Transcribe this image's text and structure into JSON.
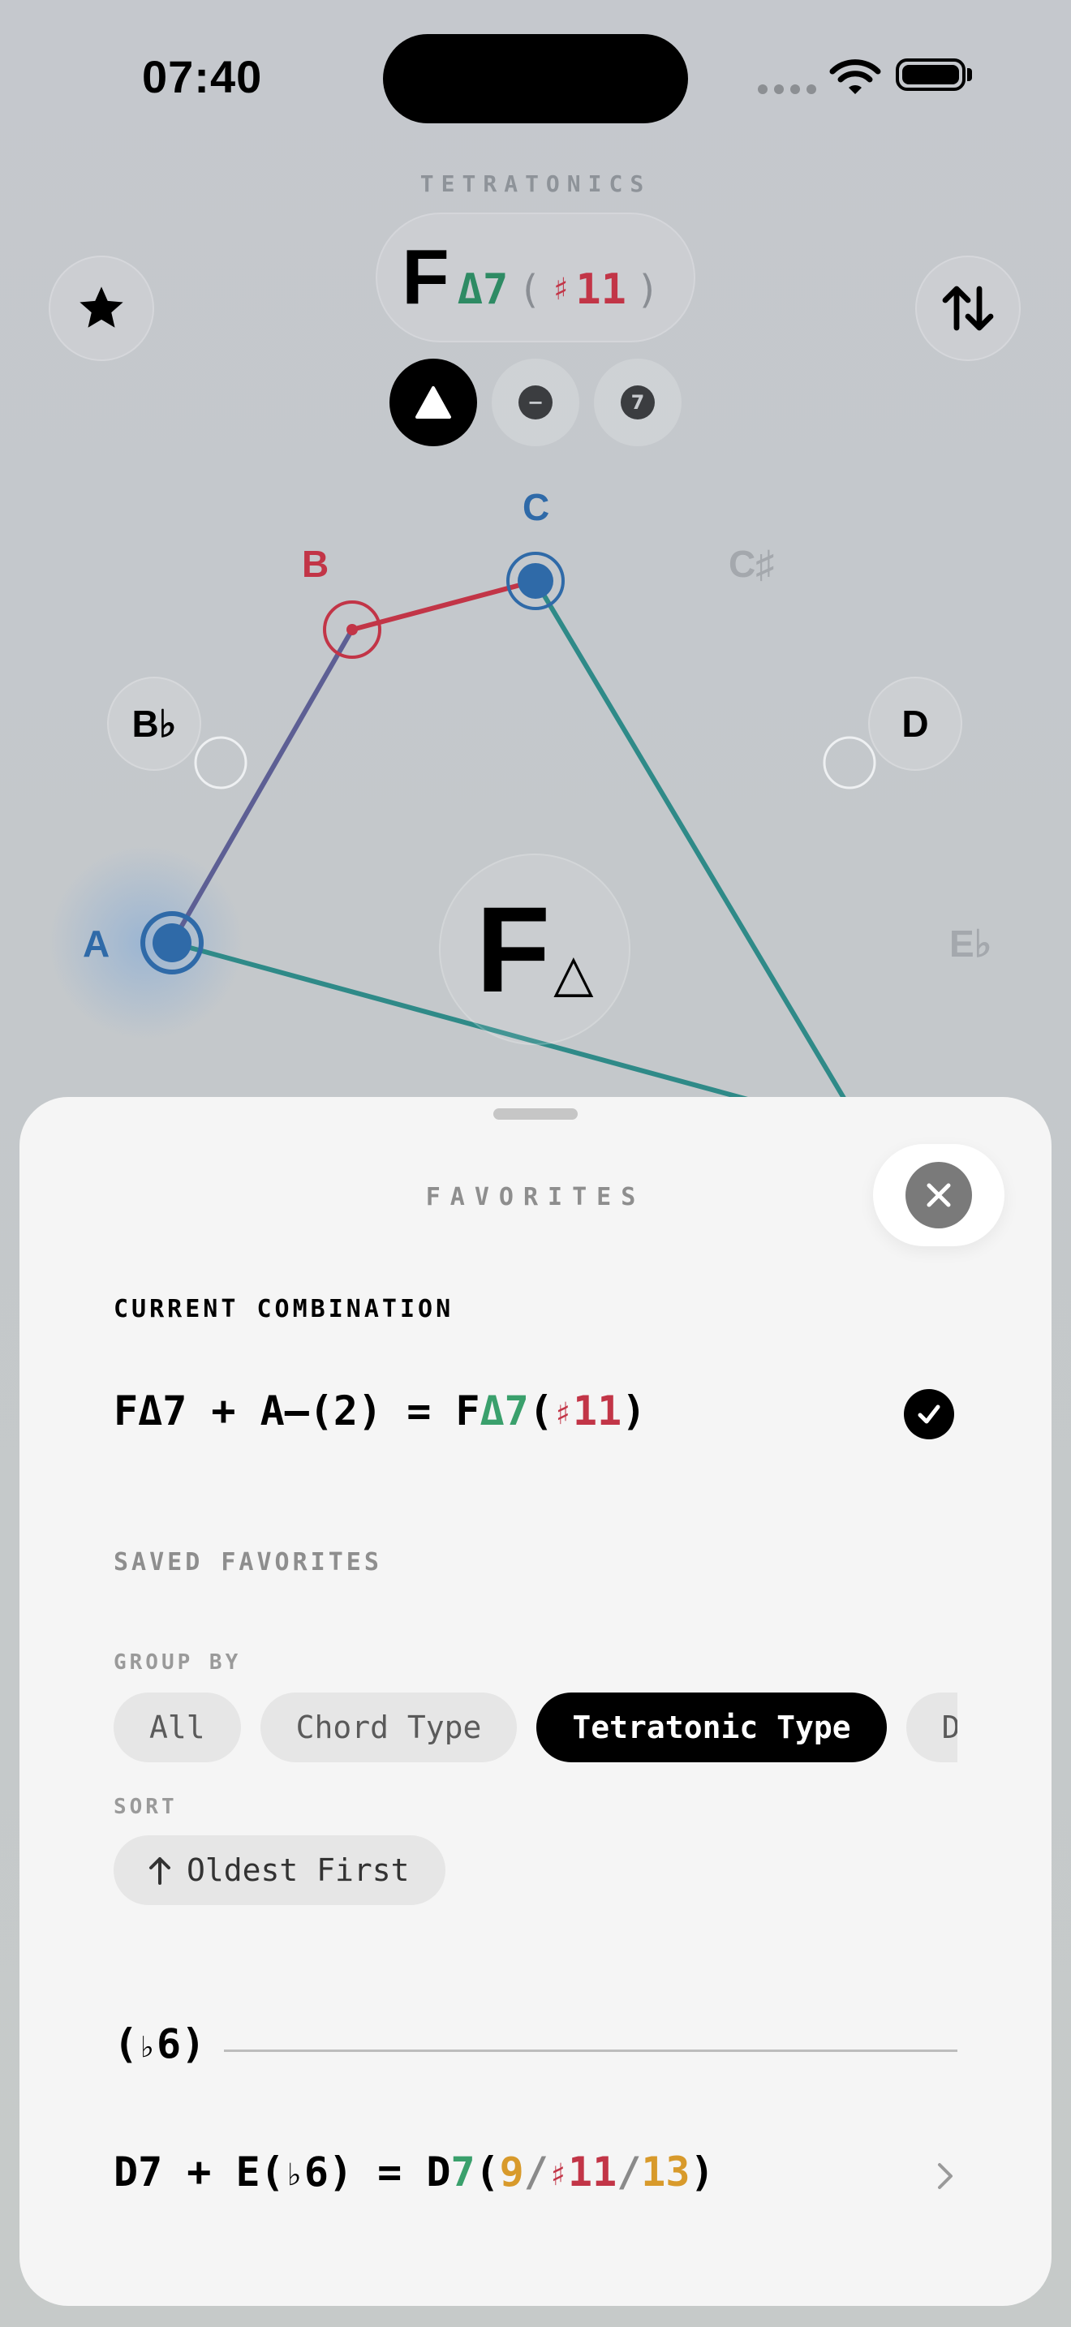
{
  "status_bar": {
    "time": "07:40"
  },
  "header": {
    "mode_label": "TETRATONICS",
    "chord": {
      "root": "F",
      "quality": "Δ7",
      "open_paren": "(",
      "sharp": "♯",
      "extension": "11",
      "close_paren": ")"
    },
    "segments": [
      {
        "name": "triangle",
        "active": true
      },
      {
        "name": "minus",
        "active": false,
        "glyph": "−"
      },
      {
        "name": "seven",
        "active": false,
        "glyph": "7"
      }
    ]
  },
  "circle": {
    "notes": {
      "c": "C",
      "b": "B",
      "csharp": "C♯",
      "bflat": "B♭",
      "d": "D",
      "a": "A",
      "eflat": "E♭"
    },
    "center": {
      "root": "F",
      "symbol": "△"
    }
  },
  "sheet": {
    "title": "FAVORITES",
    "current_heading": "CURRENT COMBINATION",
    "current": {
      "lhs": "FΔ7 + A–(2) = F",
      "q": "Δ7",
      "op": "(",
      "sharp": "♯",
      "ext": "11",
      "cp": ")"
    },
    "saved_heading": "SAVED FAVORITES",
    "group_by_label": "GROUP BY",
    "group_chips": [
      "All",
      "Chord Type",
      "Tetratonic Type",
      "Date"
    ],
    "sort_label": "SORT",
    "sort_value": "Oldest First",
    "group_title": {
      "op": "(",
      "flat": "♭",
      "num": "6",
      "cp": ")"
    },
    "item": {
      "lhs_a": "D7 + E(",
      "flat": "♭",
      "lhs_b": "6) = D",
      "q": "7",
      "op": "(",
      "e1": "9",
      "s1": "/",
      "sharp": "♯",
      "e2": "11",
      "s2": "/",
      "e3": "13",
      "cp": ")"
    }
  },
  "colors": {
    "blue": "#2f6aa8",
    "red": "#c23547",
    "teal": "#2f8a88",
    "green": "#3aa06c",
    "orange": "#d89a2b"
  }
}
